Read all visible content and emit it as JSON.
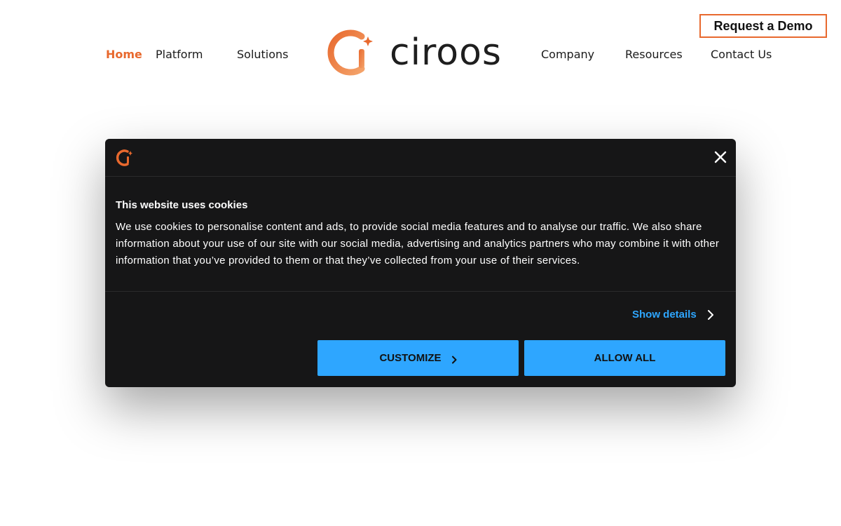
{
  "header": {
    "nav_left": [
      "Home",
      "Platform",
      "Solutions"
    ],
    "nav_right": [
      "Company",
      "Resources",
      "Contact Us"
    ],
    "active": "Home",
    "logo_text": "ciroos",
    "cta_label": "Request a Demo"
  },
  "cookie_dialog": {
    "title": "This website uses cookies",
    "body": "We use cookies to personalise content and ads, to provide social media features and to analyse our traffic. We also share information about your use of our site with our social media, advertising and analytics partners who may combine it with other information that you’ve provided to them or that they’ve collected from your use of their services.",
    "show_details_label": "Show details",
    "customize_label": "CUSTOMIZE",
    "allow_all_label": "ALLOW ALL"
  },
  "colors": {
    "brand_orange": "#e8692e",
    "accent_blue": "#2ea6ff",
    "dialog_bg": "#161617"
  },
  "icons": [
    "ciroos-logo-icon",
    "close-icon",
    "chevron-right-icon"
  ]
}
